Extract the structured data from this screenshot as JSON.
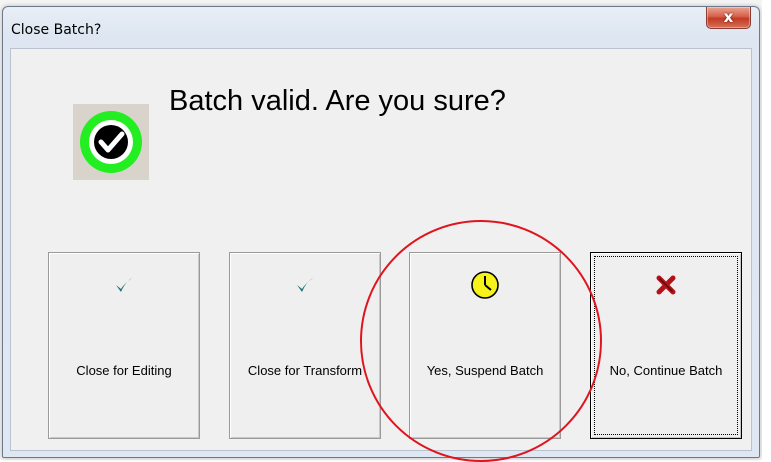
{
  "window": {
    "title": "Close Batch?",
    "close_glyph": "x"
  },
  "dialog": {
    "message": "Batch valid. Are you sure?",
    "status_icon": "green-ring-checkmark-icon"
  },
  "buttons": [
    {
      "label": "Close for Editing",
      "icon": "teal-checkmark-icon"
    },
    {
      "label": "Close for Transform",
      "icon": "teal-checkmark-icon"
    },
    {
      "label": "Yes, Suspend Batch",
      "icon": "yellow-clock-icon"
    },
    {
      "label": "No, Continue Batch",
      "icon": "red-x-icon"
    }
  ],
  "colors": {
    "check_teal": "#1f6f78",
    "clock_yellow": "#f6f21a",
    "x_red": "#b3121a",
    "ring_green": "#22ee22",
    "annotation_red": "#e0141e"
  }
}
